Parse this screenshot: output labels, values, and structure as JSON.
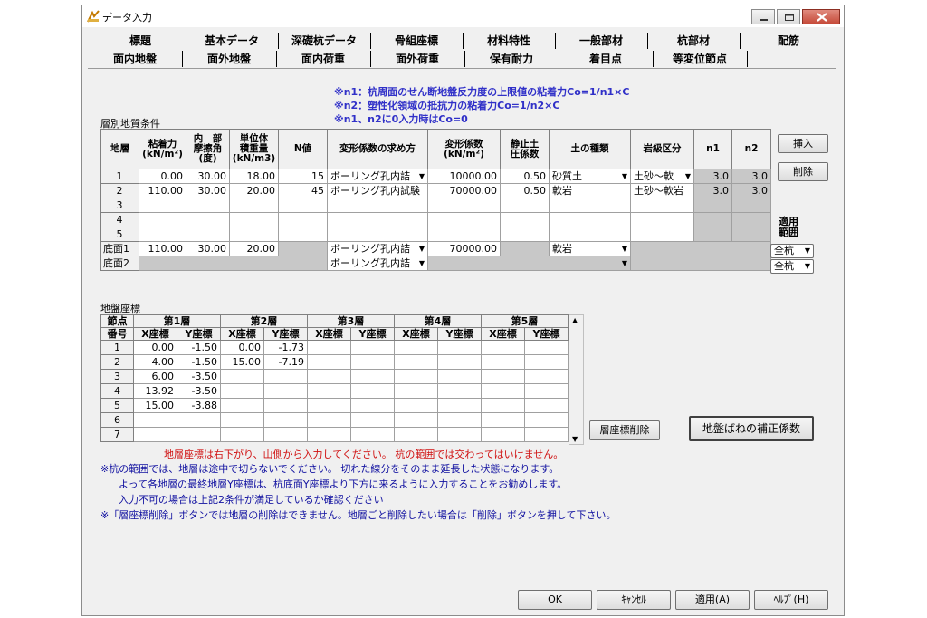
{
  "window": {
    "title": "データ入力"
  },
  "tabs_row1": [
    "標題",
    "基本データ",
    "深礎杭データ",
    "骨組座標",
    "材料特性",
    "一般部材",
    "杭部材",
    "配筋"
  ],
  "tabs_row2": [
    "面内地盤",
    "面外地盤",
    "面内荷重",
    "面外荷重",
    "保有耐力",
    "着目点",
    "等変位節点"
  ],
  "notes": {
    "n1": "※n1：杭周面のせん断地盤反力度の上限値の粘着力Co=1/n1×C",
    "n2": "※n2：塑性化領域の抵抗力の粘着力Co=1/n2×C",
    "n3": "※n1、n2に0入力時はCo=0"
  },
  "soil": {
    "section_title": "層別地質条件",
    "headers": [
      "地層",
      "粘着力\n(kN/m²)",
      "内　部\n摩擦角\n(度)",
      "単位体\n積重量\n(kN/m3)",
      "N値",
      "変形係数の求め方",
      "変形係数\n(kN/m²)",
      "静止土\n圧係数",
      "土の種類",
      "岩級区分",
      "n1",
      "n2"
    ],
    "rows": [
      [
        "1",
        "0.00",
        "30.00",
        "18.00",
        "15",
        "ボーリング孔内詰",
        "10000.00",
        "0.50",
        "砂質土",
        "土砂～軟",
        "3.0",
        "3.0"
      ],
      [
        "2",
        "110.00",
        "30.00",
        "20.00",
        "45",
        "ボーリング孔内試験",
        "70000.00",
        "0.50",
        "軟岩",
        "土砂～軟岩",
        "3.0",
        "3.0"
      ],
      [
        "3",
        "",
        "",
        "",
        "",
        "",
        "",
        "",
        "",
        "",
        "",
        ""
      ],
      [
        "4",
        "",
        "",
        "",
        "",
        "",
        "",
        "",
        "",
        "",
        "",
        ""
      ],
      [
        "5",
        "",
        "",
        "",
        "",
        "",
        "",
        "",
        "",
        "",
        "",
        ""
      ]
    ],
    "bottom1": [
      "底面1",
      "110.00",
      "30.00",
      "20.00",
      "",
      "ボーリング孔内詰",
      "70000.00",
      "",
      "軟岩",
      "",
      "全杭"
    ],
    "bottom2": [
      "底面2",
      "",
      "",
      "",
      "",
      "ボーリング孔内詰",
      "",
      "",
      "",
      "",
      "全杭"
    ],
    "insert_label": "挿入",
    "delete_label": "削除",
    "range_label": "適用範囲"
  },
  "coords": {
    "section_title": "地盤座標",
    "head1": [
      "節点",
      "第1層",
      "第2層",
      "第3層",
      "第4層",
      "第5層"
    ],
    "head2": [
      "番号",
      "X座標",
      "Y座標",
      "X座標",
      "Y座標",
      "X座標",
      "Y座標",
      "X座標",
      "Y座標",
      "X座標",
      "Y座標"
    ],
    "rows": [
      [
        "1",
        "0.00",
        "-1.50",
        "0.00",
        "-1.73",
        "",
        "",
        "",
        "",
        "",
        ""
      ],
      [
        "2",
        "4.00",
        "-1.50",
        "15.00",
        "-7.19",
        "",
        "",
        "",
        "",
        "",
        ""
      ],
      [
        "3",
        "6.00",
        "-3.50",
        "",
        "",
        "",
        "",
        "",
        "",
        "",
        ""
      ],
      [
        "4",
        "13.92",
        "-3.50",
        "",
        "",
        "",
        "",
        "",
        "",
        "",
        ""
      ],
      [
        "5",
        "15.00",
        "-3.88",
        "",
        "",
        "",
        "",
        "",
        "",
        "",
        ""
      ],
      [
        "6",
        "",
        "",
        "",
        "",
        "",
        "",
        "",
        "",
        "",
        ""
      ],
      [
        "7",
        "",
        "",
        "",
        "",
        "",
        "",
        "",
        "",
        "",
        ""
      ]
    ],
    "delete_coords_label": "層座標削除",
    "spring_label": "地盤ばねの補正係数"
  },
  "warnings": {
    "red": "地層座標は右下がり、山側から入力してください。 杭の範囲では交わってはいけません。",
    "l1": "※杭の範囲では、地層は途中で切らないでください。 切れた線分をそのまま延長した状態になります。",
    "l2": "よって各地層の最終地層Y座標は、杭底面Y座標より下方に来るように入力することをお勧めします。",
    "l3": "入力不可の場合は上記2条件が満足しているか確認ください",
    "l4": "※「層座標削除」ボタンでは地層の削除はできません。地層ごと削除したい場合は「削除」ボタンを押して下さい。"
  },
  "footer": {
    "ok": "OK",
    "cancel": "ｷｬﾝｾﾙ",
    "apply": "適用(A)",
    "help": "ﾍﾙﾌﾟ(H)"
  }
}
